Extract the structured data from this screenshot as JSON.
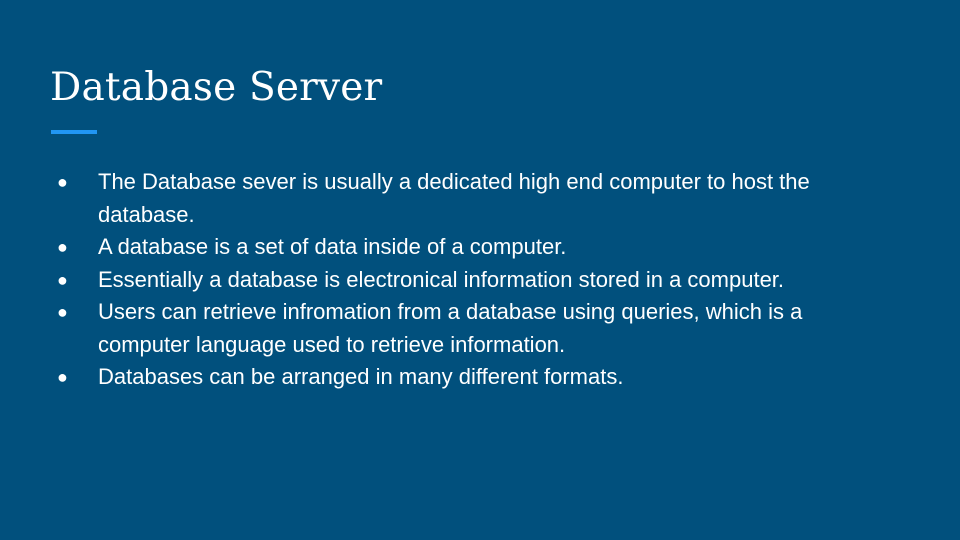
{
  "slide": {
    "title": "Database Server",
    "accent_color": "#2196f3",
    "background_color": "#01507d",
    "bullet_glyph": "●",
    "bullets": [
      "The Database sever is usually a dedicated high end computer to host the database.",
      "A database is a set of data inside of a computer.",
      "Essentially a database is electronical information stored in a computer.",
      "Users can retrieve infromation from a database using queries, which is a computer language used to retrieve information.",
      "Databases can be arranged in many different formats."
    ]
  }
}
